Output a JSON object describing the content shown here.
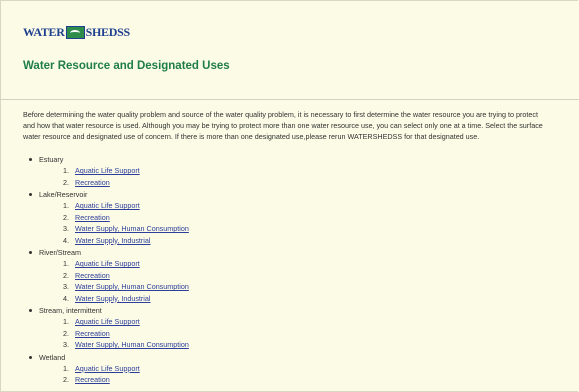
{
  "header": {
    "logo": {
      "text_left": "WATER",
      "text_right": "SHEDSS",
      "icon": "watershed-logo-icon"
    },
    "title": "Water Resource and Designated Uses"
  },
  "intro": {
    "lines": [
      "Before determining the water quality problem and source of the water quality problem, it is necessary to first determine the water resource you are trying to protect",
      "and how that water resource is used. Although you may be trying to protect more than one water resource use, you can select only one at a time. Select the surface",
      "water resource and designated use of concern. If there is more than one designated use,please rerun WATERSHEDSS for that designated use."
    ]
  },
  "resources": [
    {
      "label": "Estuary",
      "uses": [
        "Aquatic Life Support",
        "Recreation"
      ]
    },
    {
      "label": "Lake/Reservoir",
      "uses": [
        "Aquatic Life Support",
        "Recreation",
        "Water Supply, Human Consumption",
        "Water Supply, Industrial"
      ]
    },
    {
      "label": "River/Stream",
      "uses": [
        "Aquatic Life Support",
        "Recreation",
        "Water Supply, Human Consumption",
        "Water Supply, Industrial"
      ]
    },
    {
      "label": "Stream, intermittent",
      "uses": [
        "Aquatic Life Support",
        "Recreation",
        "Water Supply, Human Consumption"
      ]
    },
    {
      "label": "Wetland",
      "uses": [
        "Aquatic Life Support",
        "Recreation"
      ]
    }
  ],
  "colors": {
    "background": "#fbfbe6",
    "title_green": "#1f7e45",
    "link_blue": "#2d3e9b",
    "logo_blue": "#1f3f8f"
  }
}
